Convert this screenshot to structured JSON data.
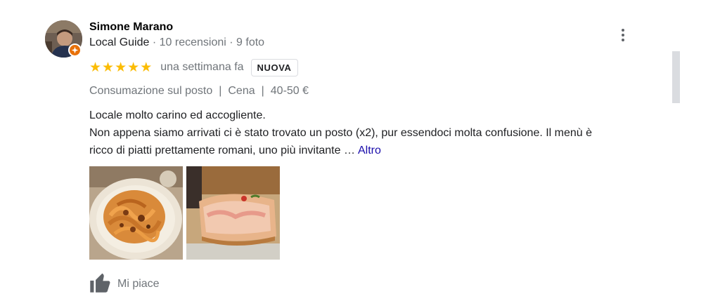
{
  "reviewer": {
    "name": "Simone Marano",
    "local_guide_label": "Local Guide",
    "meta_sep": "·",
    "reviews_count": "10 recensioni",
    "photos_count": "9 foto"
  },
  "rating": {
    "stars": 5,
    "max_stars": 5,
    "time_ago": "una settimana fa",
    "badge": "NUOVA"
  },
  "attributes": {
    "service": "Consumazione sul posto",
    "meal": "Cena",
    "price": "40-50 €",
    "separator": "|"
  },
  "review": {
    "line1": "Locale molto carino ed accogliente.",
    "line2": "Non appena siamo arrivati ci è stato trovato un posto (x2), pur essendoci molta confusione. Il menù è",
    "line3": "ricco di piatti prettamente romani, uno più invitante …",
    "more_link": "Altro"
  },
  "photos": [
    {
      "icon": "pasta-dish-photo"
    },
    {
      "icon": "pizza-slice-photo"
    }
  ],
  "actions": {
    "like_label": "Mi piace"
  },
  "colors": {
    "star": "#fbbc04",
    "link": "#1a0dab",
    "secondary_text": "#70757a",
    "guide_badge": "#e8710a"
  }
}
